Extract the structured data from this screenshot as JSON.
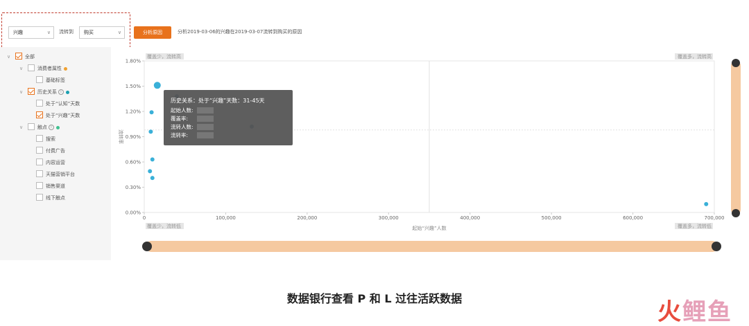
{
  "toolbar": {
    "from_select": "兴趣",
    "flow_label": "流转到",
    "to_select": "购买",
    "analyze_button": "分析原因",
    "analyze_description": "分析2019-03-06的兴趣在2019-03-07流转到购买的原因"
  },
  "tree": [
    {
      "label": "全部",
      "level": 0,
      "checked": true,
      "toggle": "∨"
    },
    {
      "label": "消费者属性",
      "level": 1,
      "checked": false,
      "toggle": "∨",
      "dot": "#f0a030"
    },
    {
      "label": "基础标签",
      "level": 2,
      "checked": false
    },
    {
      "label": "历史关系",
      "level": 1,
      "checked": true,
      "toggle": "∨",
      "info": true,
      "dot": "#1a9fb0"
    },
    {
      "label": "处于“认知”天数",
      "level": 2,
      "checked": false
    },
    {
      "label": "处于“兴趣”天数",
      "level": 2,
      "checked": true
    },
    {
      "label": "触点",
      "level": 1,
      "checked": false,
      "toggle": "∨",
      "info": true,
      "dot": "#40c090"
    },
    {
      "label": "搜索",
      "level": 2,
      "checked": false
    },
    {
      "label": "付费广告",
      "level": 2,
      "checked": false
    },
    {
      "label": "内容运营",
      "level": 2,
      "checked": false
    },
    {
      "label": "天猫营销平台",
      "level": 2,
      "checked": false
    },
    {
      "label": "销售渠道",
      "level": 2,
      "checked": false
    },
    {
      "label": "线下触点",
      "level": 2,
      "checked": false
    }
  ],
  "chart_data": {
    "type": "scatter",
    "xlabel": "起始“兴趣”人数",
    "ylabel": "流转率",
    "x_ticks": [
      "0",
      "100,000",
      "200,000",
      "300,000",
      "400,000",
      "500,000",
      "600,000",
      "700,000"
    ],
    "y_ticks": [
      "0.00%",
      "0.30%",
      "0.60%",
      "0.90%",
      "1.20%",
      "1.50%",
      "1.80%"
    ],
    "xlim": [
      0,
      700000
    ],
    "ylim": [
      0,
      1.8
    ],
    "quadrant_divider": {
      "x": 350000,
      "y": 0.98
    },
    "quadrant_labels": {
      "top_left": "覆盖少，流转高",
      "top_right": "覆盖多，流转高",
      "bottom_left": "覆盖少，流转低",
      "bottom_right": "覆盖多，流转低"
    },
    "points": [
      {
        "x": 16000,
        "y": 1.51,
        "r": 5,
        "color": "#3ab0d8"
      },
      {
        "x": 40000,
        "y": 1.38,
        "r": 3,
        "color": "#2a6a8a"
      },
      {
        "x": 9000,
        "y": 1.19,
        "r": 3,
        "color": "#3ab0d8"
      },
      {
        "x": 8000,
        "y": 0.96,
        "r": 3,
        "color": "#3ab0d8"
      },
      {
        "x": 10000,
        "y": 0.63,
        "r": 3,
        "color": "#3ab0d8"
      },
      {
        "x": 7000,
        "y": 0.49,
        "r": 3,
        "color": "#3ab0d8"
      },
      {
        "x": 10000,
        "y": 0.41,
        "r": 3,
        "color": "#3ab0d8"
      },
      {
        "x": 132000,
        "y": 1.02,
        "r": 3,
        "color": "#2a6a8a"
      },
      {
        "x": 690000,
        "y": 0.1,
        "r": 3,
        "color": "#3ab0d8"
      }
    ]
  },
  "tooltip": {
    "title": "历史关系：处于“兴趣”天数：31-45天",
    "rows": [
      "起始人数:",
      "覆盖率:",
      "流转人数:",
      "流转率:"
    ]
  },
  "caption": "数据银行查看 P 和 L 过往活跃数据",
  "logo": {
    "part1": "火",
    "part2": "鲤鱼"
  },
  "colors": {
    "accent": "#e8721c",
    "slider": "#f5c9a0",
    "point": "#3ab0d8"
  }
}
